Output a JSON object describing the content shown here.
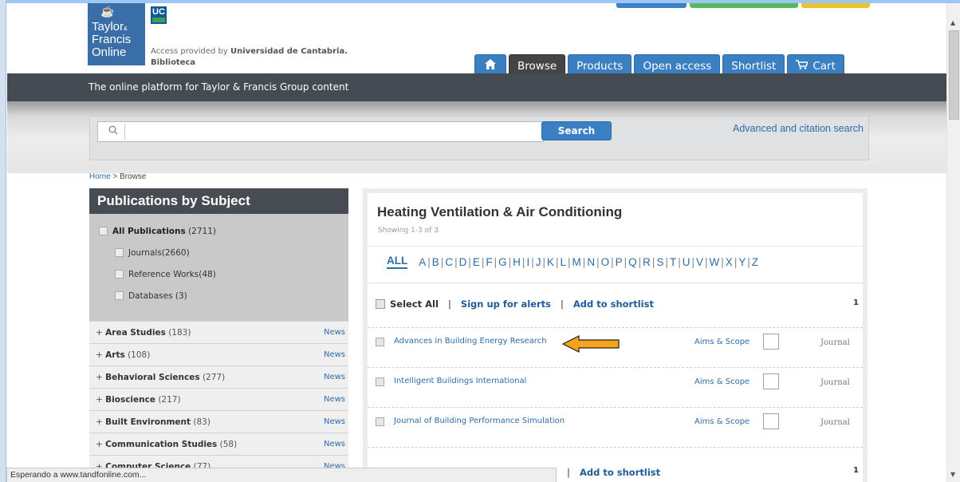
{
  "header": {
    "logo": {
      "line1": "Taylor",
      "amp": "&",
      "line2": "Francis",
      "line3": "Online"
    },
    "uc_logo": "UC",
    "access_prefix": "Access provided by",
    "access_org": "Universidad de Cantabria.",
    "access_org2": "Biblioteca",
    "top_tab_colors": [
      "#3b7fc4",
      "#5cb85c",
      "#e8c42a"
    ]
  },
  "nav": {
    "tabs": [
      {
        "label": "",
        "icon": "home-icon"
      },
      {
        "label": "Browse",
        "active": true
      },
      {
        "label": "Products"
      },
      {
        "label": "Open access"
      },
      {
        "label": "Shortlist"
      },
      {
        "label": "Cart",
        "icon": "cart-icon"
      }
    ]
  },
  "tagline": "The online platform for Taylor & Francis Group content",
  "search": {
    "placeholder": "",
    "button": "Search",
    "advanced_link": "Advanced and citation search"
  },
  "breadcrumb": {
    "home": "Home",
    "sep": ">",
    "current": "Browse"
  },
  "sidebar": {
    "title": "Publications by Subject",
    "publications": [
      {
        "label": "All Publications",
        "count": "(2711)"
      },
      {
        "label": "Journals(2660)"
      },
      {
        "label": "Reference Works(48)"
      },
      {
        "label": "Databases (3)"
      }
    ],
    "subjects": [
      {
        "label": "Area Studies",
        "count": "(183)",
        "news": "News"
      },
      {
        "label": "Arts",
        "count": "(108)",
        "news": "News"
      },
      {
        "label": "Behavioral Sciences",
        "count": "(277)",
        "news": "News"
      },
      {
        "label": "Bioscience",
        "count": "(217)",
        "news": "News"
      },
      {
        "label": "Built Environment",
        "count": "(83)",
        "news": "News"
      },
      {
        "label": "Communication Studies",
        "count": "(58)",
        "news": "News"
      },
      {
        "label": "Computer Science",
        "count": "(77)",
        "news": "News"
      }
    ]
  },
  "main": {
    "title": "Heating Ventilation & Air Conditioning",
    "showing": "Showing 1-3 of 3",
    "alpha_all": "ALL",
    "letters": [
      "A",
      "B",
      "C",
      "D",
      "E",
      "F",
      "G",
      "H",
      "I",
      "J",
      "K",
      "L",
      "M",
      "N",
      "O",
      "P",
      "Q",
      "R",
      "S",
      "T",
      "U",
      "V",
      "W",
      "X",
      "Y",
      "Z"
    ],
    "toolbar": {
      "select_all": "Select All",
      "alerts": "Sign up for alerts",
      "shortlist": "Add to shortlist",
      "page": "1"
    },
    "rows": [
      {
        "name": "Advances in Building Energy Research",
        "aims": "Aims & Scope",
        "type": "Journal",
        "highlighted": true
      },
      {
        "name": "Intelligent Buildings International",
        "aims": "Aims & Scope",
        "type": "Journal"
      },
      {
        "name": "Journal of Building Performance Simulation",
        "aims": "Aims & Scope",
        "type": "Journal"
      }
    ],
    "arrow_color": "#f7a21b"
  },
  "statusbar": "Esperando a www.tandfonline.com..."
}
